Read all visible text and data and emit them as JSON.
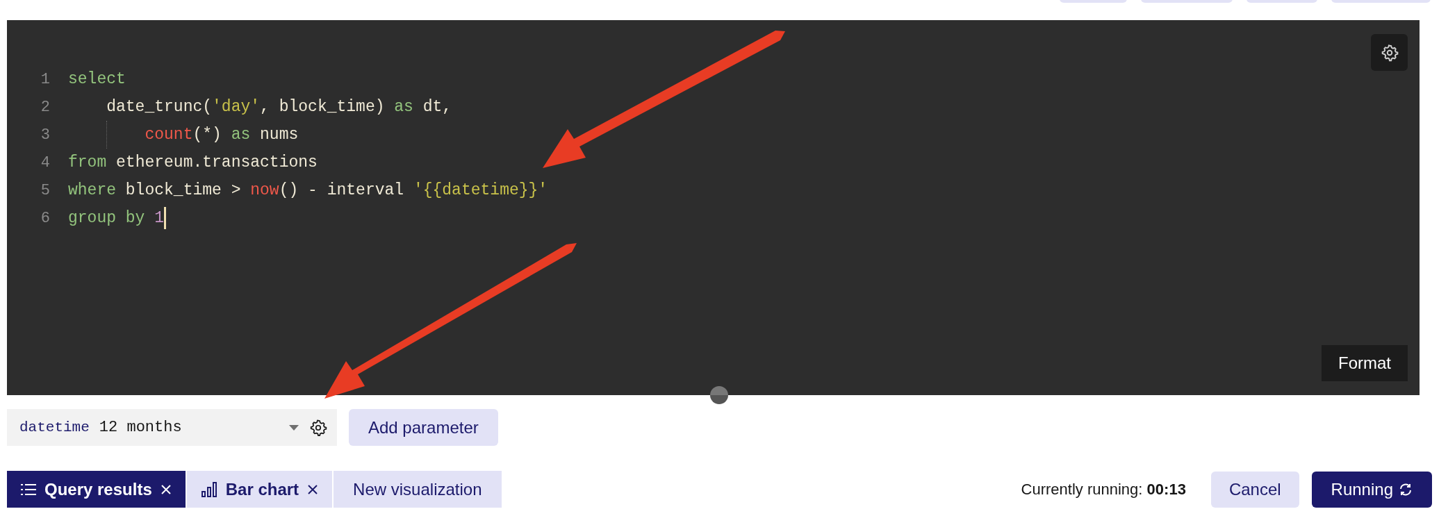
{
  "editor": {
    "lines": [
      {
        "number": "1",
        "indent_guide": false,
        "cursor": false,
        "tokens": [
          {
            "text": "select",
            "kind": "keyword"
          }
        ]
      },
      {
        "number": "2",
        "indent_guide": false,
        "cursor": false,
        "tokens": [
          {
            "text": "    date_trunc(",
            "kind": "plain"
          },
          {
            "text": "'day'",
            "kind": "string"
          },
          {
            "text": ", block_time) ",
            "kind": "plain"
          },
          {
            "text": "as",
            "kind": "keyword"
          },
          {
            "text": " dt,",
            "kind": "plain"
          }
        ]
      },
      {
        "number": "3",
        "indent_guide": true,
        "cursor": false,
        "tokens": [
          {
            "text": "        count",
            "kind": "function"
          },
          {
            "text": "(*) ",
            "kind": "plain"
          },
          {
            "text": "as",
            "kind": "keyword"
          },
          {
            "text": " nums",
            "kind": "plain"
          }
        ]
      },
      {
        "number": "4",
        "indent_guide": false,
        "cursor": false,
        "tokens": [
          {
            "text": "from",
            "kind": "keyword"
          },
          {
            "text": " ethereum.transactions",
            "kind": "plain"
          }
        ]
      },
      {
        "number": "5",
        "indent_guide": false,
        "cursor": false,
        "tokens": [
          {
            "text": "where",
            "kind": "keyword"
          },
          {
            "text": " block_time > ",
            "kind": "plain"
          },
          {
            "text": "now",
            "kind": "function"
          },
          {
            "text": "() - interval ",
            "kind": "plain"
          },
          {
            "text": "'{{datetime}}'",
            "kind": "string"
          }
        ]
      },
      {
        "number": "6",
        "indent_guide": false,
        "cursor": true,
        "tokens": [
          {
            "text": "group by ",
            "kind": "keyword"
          },
          {
            "text": "1",
            "kind": "number"
          }
        ]
      }
    ],
    "format_button": "Format"
  },
  "parameters": [
    {
      "name": "datetime",
      "value": "12 months"
    }
  ],
  "add_parameter_button": "Add parameter",
  "tabs": [
    {
      "label": "Query results",
      "selected": true,
      "kind": "list",
      "closable": true
    },
    {
      "label": "Bar chart",
      "selected": false,
      "kind": "chart",
      "closable": true
    },
    {
      "label": "New visualization",
      "selected": false,
      "kind": "plain",
      "closable": false
    }
  ],
  "status": {
    "label": "Currently running:",
    "time": "00:13"
  },
  "cancel_button": "Cancel",
  "run_button": {
    "label": "Running",
    "running": true
  }
}
